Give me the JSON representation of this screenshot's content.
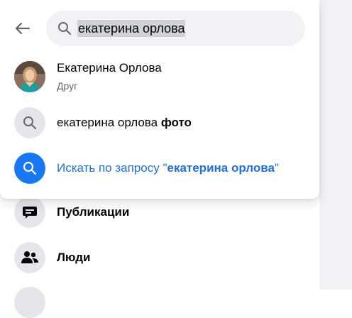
{
  "search": {
    "query": "екатерина орлова"
  },
  "results": {
    "person": {
      "name": "Екатерина Орлова",
      "relation": "Друг"
    },
    "suggestion": {
      "text": "екатерина орлова",
      "suffix": "фото"
    },
    "search_all": {
      "prefix": "Искать по запросу \"",
      "query": "екатерина орлова",
      "suffix": "\""
    }
  },
  "background_menu": {
    "items": [
      {
        "label": "Публикации",
        "icon": "posts-icon"
      },
      {
        "label": "Люди",
        "icon": "people-icon"
      }
    ]
  },
  "colors": {
    "accent": "#1877f2",
    "link": "#216fdb",
    "panel_bg": "#ffffff",
    "search_bg": "#f0f2f5"
  }
}
